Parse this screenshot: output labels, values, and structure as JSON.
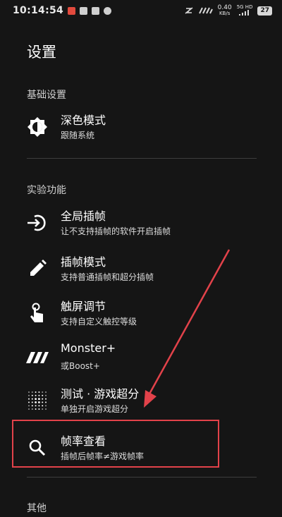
{
  "status_bar": {
    "time": "10:14:54",
    "net_speed_value": "0.40",
    "net_speed_unit": "KB/s",
    "signal_label": "5G HD",
    "battery": "27",
    "accent_colors": [
      "#e24a3d",
      "#f0c020"
    ]
  },
  "page": {
    "title": "设置"
  },
  "sections": {
    "basic": {
      "header": "基础设置"
    },
    "experimental": {
      "header": "实验功能"
    },
    "other": {
      "header": "其他"
    }
  },
  "items": {
    "dark_mode": {
      "title": "深色模式",
      "subtitle": "跟随系统",
      "icon": "brightness-icon"
    },
    "global_interp": {
      "title": "全局插帧",
      "subtitle": "让不支持插帧的软件开启插帧",
      "icon": "login-arrow-icon"
    },
    "interp_mode": {
      "title": "插帧模式",
      "subtitle": "支持普通插帧和超分插帧",
      "icon": "pencil-icon"
    },
    "touch_adjust": {
      "title": "触屏调节",
      "subtitle": "支持自定义触控等级",
      "icon": "touch-icon"
    },
    "monster": {
      "title": "Monster+",
      "subtitle": "或Boost+",
      "icon": "monster-logo-icon"
    },
    "test_super": {
      "title": "测试 · 游戏超分",
      "subtitle": "单独开启游戏超分",
      "icon": "dot-grid-icon"
    },
    "fps_view": {
      "title": "帧率查看",
      "subtitle": "插帧后帧率≠游戏帧率",
      "icon": "search-icon"
    }
  },
  "annotation": {
    "color": "#e2424a"
  }
}
